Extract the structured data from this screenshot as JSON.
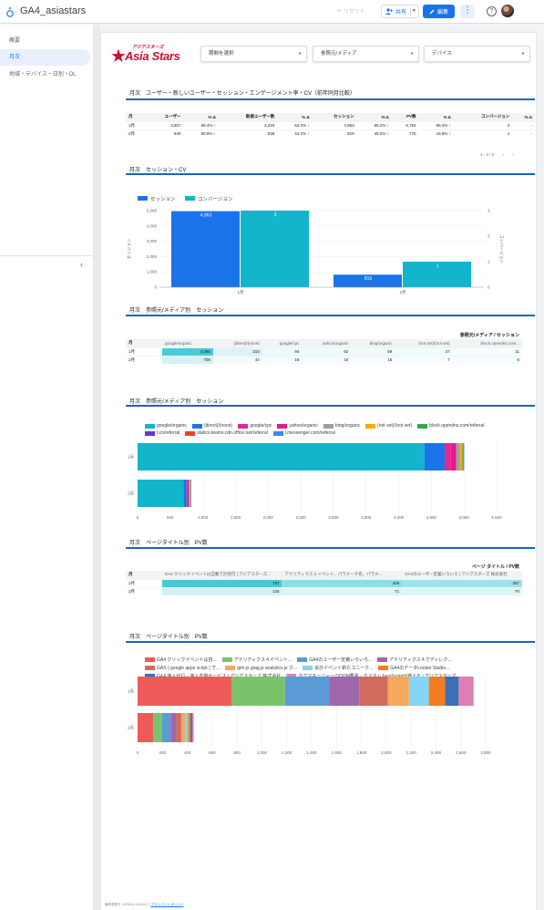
{
  "app": {
    "title": "GA4_asiastars",
    "reset_label": "リセット",
    "share_label": "共有",
    "edit_label": "編集"
  },
  "sidebar": {
    "items": [
      {
        "label": "概要",
        "active": false
      },
      {
        "label": "月次",
        "active": true
      },
      {
        "label": "地域・デバイス・日別・DL",
        "active": false
      }
    ]
  },
  "report": {
    "logo": {
      "sub": "アジアスターズ",
      "main": "Asia Stars"
    },
    "filters": [
      {
        "label": "期間を選択"
      },
      {
        "label": "参照元/メディア"
      },
      {
        "label": "デバイス"
      }
    ],
    "footer": {
      "text": "最終更新日: 2023/3/4 13:39:17 | ",
      "link": "プライバシー ポリシー"
    }
  },
  "sections": {
    "s1": {
      "title": "月次　ユーザー・新しいユーザー・セッション・エンゲージメント率・CV（前年同月比較）"
    },
    "s2": {
      "title": "月次　セッション・CV"
    },
    "s3": {
      "title": "月次　参照元/メディア別　セッション"
    },
    "s4": {
      "title": "月次　参照元/メディア別　セッション"
    },
    "s5": {
      "title": "月次　ページタイトル別　PV数"
    },
    "s6": {
      "title": "月次　ページタイトル別　PV数"
    }
  },
  "table1": {
    "columns": [
      "月",
      "ユーザー",
      "% Δ",
      "新規ユーザー数",
      "% Δ",
      "セッション",
      "% Δ",
      "PV数",
      "% Δ",
      "コンバージョン",
      "% Δ"
    ],
    "rows": [
      [
        "1月",
        "3,507",
        "68.4% ↑",
        "3,220",
        "63.2% ↑",
        "4,963",
        "66.2% ↑",
        "6,764",
        "58.4% ↑",
        "3",
        "-"
      ],
      [
        "2月",
        "640",
        "50.9% ↑",
        "535",
        "44.2% ↑",
        "819",
        "49.2% ↑",
        "775",
        "43.8% ↑",
        "1",
        "-"
      ]
    ],
    "pager": "1 - 2 / 2"
  },
  "table2": {
    "group_header": "参照元/メディア / セッション",
    "columns": [
      "月",
      "google/organic",
      "(direct)/(none)",
      "google/cpc",
      "yahoo/organic",
      "bing/organic",
      "(not set)/(not set)",
      "block.opendns.com..."
    ],
    "rows": [
      [
        "1月",
        "4,395",
        "310",
        "94",
        "82",
        "59",
        "37",
        "11"
      ],
      [
        "2月",
        "706",
        "44",
        "16",
        "16",
        "15",
        "7",
        "6"
      ]
    ]
  },
  "table3": {
    "group_header": "ページ タイトル / PV数",
    "columns": [
      "月",
      "GA4 クリックイベントは自動で計測可 | アジアスターズ...",
      "アナリティクス 4 イベント、パラメータ名、パラメ...",
      "GA4のユーザー定義いろいろ | アジアスターズ 株式会社"
    ],
    "rows": [
      [
        "1月",
        "757",
        "429",
        "357"
      ],
      [
        "2月",
        "125",
        "71",
        "70"
      ]
    ]
  },
  "chart_data": [
    {
      "type": "bar",
      "title": "",
      "categories": [
        "1月",
        "2月"
      ],
      "series": [
        {
          "name": "セッション",
          "values": [
            4963,
            819
          ],
          "color": "#1a73e8",
          "axis": "left"
        },
        {
          "name": "コンバージョン",
          "values": [
            3,
            1
          ],
          "color": "#12b5cb",
          "axis": "right"
        }
      ],
      "ylabel": "セッション",
      "y2label": "コンバージョン",
      "ylim": [
        0,
        5000
      ],
      "y2lim": [
        0,
        3
      ],
      "yticks": [
        "0",
        "1,000",
        "2,000",
        "3,000",
        "4,000",
        "5,000"
      ],
      "y2ticks": [
        "0",
        "1",
        "2",
        "3"
      ],
      "data_labels": [
        "4,963",
        "3",
        "819",
        "1"
      ],
      "legend": "top-left",
      "grid": true
    },
    {
      "type": "bar",
      "orientation": "horizontal",
      "stacked": true,
      "categories": [
        "1月",
        "2月"
      ],
      "series": [
        {
          "name": "google/organic",
          "values": [
            4395,
            706
          ],
          "color": "#12b5cb"
        },
        {
          "name": "(direct)/(none)",
          "values": [
            310,
            44
          ],
          "color": "#1a73e8"
        },
        {
          "name": "google/cpc",
          "values": [
            94,
            16
          ],
          "color": "#e52592"
        },
        {
          "name": "yahoo/organic",
          "values": [
            82,
            16
          ],
          "color": "#e8178a"
        },
        {
          "name": "bing/organic",
          "values": [
            59,
            15
          ],
          "color": "#9aa0a6"
        },
        {
          "name": "(not set)/(not set)",
          "values": [
            37,
            7
          ],
          "color": "#f9ab00"
        },
        {
          "name": "block.opendns.com/referral",
          "values": [
            11,
            6
          ],
          "color": "#34a853"
        },
        {
          "name": "t.co/referral",
          "values": [
            6,
            2
          ],
          "color": "#673ab7"
        },
        {
          "name": "statics.teams.cdn.office.net/referral",
          "values": [
            4,
            2
          ],
          "color": "#e94235"
        },
        {
          "name": "l.messenger.com/referral",
          "values": [
            3,
            1
          ],
          "color": "#4285f4"
        }
      ],
      "xlim": [
        0,
        5500
      ],
      "xticks": [
        "0",
        "500",
        "1,000",
        "1,500",
        "2,000",
        "2,500",
        "3,000",
        "3,500",
        "4,000",
        "4,500",
        "5,000",
        "5,500"
      ],
      "legend": "top-left",
      "grid": true
    },
    {
      "type": "bar",
      "orientation": "horizontal",
      "stacked": true,
      "categories": [
        "1月",
        "2月"
      ],
      "series": [
        {
          "name": "GA4 クリックイベントは自...",
          "values": [
            757,
            125
          ],
          "color": "#ee5a5a"
        },
        {
          "name": "アナリティクス４イベント...",
          "values": [
            429,
            71
          ],
          "color": "#7ac36a"
        },
        {
          "name": "GA4のユーザー定義いろいろ...",
          "values": [
            357,
            70
          ],
          "color": "#5b9bd5"
        },
        {
          "name": "アナリティクス４でディレク...",
          "values": [
            240,
            45
          ],
          "color": "#9e67ab"
        },
        {
          "name": "GAS ( google apps script ) で...",
          "values": [
            230,
            40
          ],
          "color": "#d06b5e"
        },
        {
          "name": "gtm.js gtag.js analytics.js ク...",
          "values": [
            170,
            30
          ],
          "color": "#f6a85b"
        },
        {
          "name": "会計イベント新たユニーク...",
          "values": [
            160,
            25
          ],
          "color": "#85d3f5"
        },
        {
          "name": "GA4のデータLooker Studio...",
          "values": [
            130,
            18
          ],
          "color": "#f47c20"
        },
        {
          "name": "GA4 導入代行・導入支援サービス | アジアスターズ 株式会社",
          "values": [
            110,
            15
          ],
          "color": "#3c6fb3"
        },
        {
          "name": "タグマネージャーのDOM要素・カスタムJavaScriptが使える | アジアスターズ...",
          "values": [
            120,
            12
          ],
          "color": "#e07fb3"
        }
      ],
      "xlim": [
        0,
        2800
      ],
      "xticks": [
        "0",
        "200",
        "400",
        "600",
        "800",
        "1,000",
        "1,200",
        "1,400",
        "1,600",
        "1,800",
        "2,000",
        "2,200",
        "2,400",
        "2,600",
        "2,800"
      ],
      "legend": "top-left",
      "grid": true
    }
  ]
}
